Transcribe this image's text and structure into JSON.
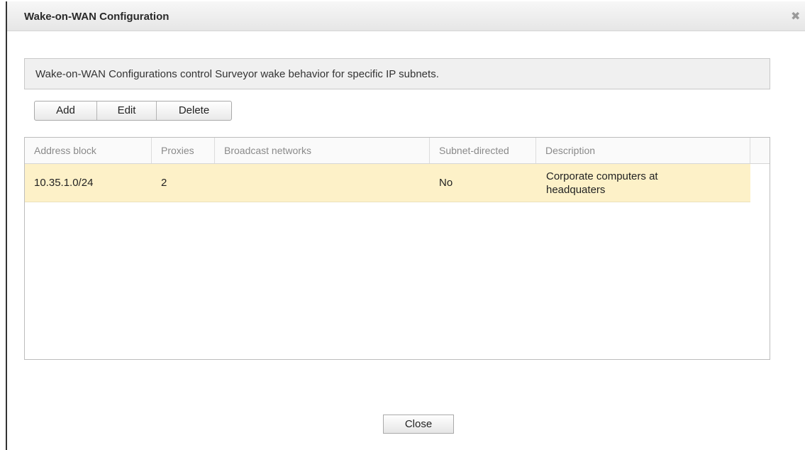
{
  "dialog": {
    "title": "Wake-on-WAN Configuration",
    "close_icon": "close-icon",
    "close_glyph": "✖",
    "info_text": "Wake-on-WAN Configurations control Surveyor wake behavior for specific IP subnets."
  },
  "toolbar": {
    "add_label": "Add",
    "edit_label": "Edit",
    "delete_label": "Delete"
  },
  "table": {
    "columns": [
      "Address block",
      "Proxies",
      "Broadcast networks",
      "Subnet-directed",
      "Description"
    ],
    "rows": [
      {
        "address_block": "10.35.1.0/24",
        "proxies": "2",
        "broadcast_networks": "",
        "subnet_directed": "No",
        "description": "Corporate computers at headquaters"
      }
    ]
  },
  "footer": {
    "close_label": "Close"
  },
  "colors": {
    "selected_row": "#fdf1c8",
    "info_bg": "#f0f0f0",
    "header_text": "#8a8a8a"
  }
}
